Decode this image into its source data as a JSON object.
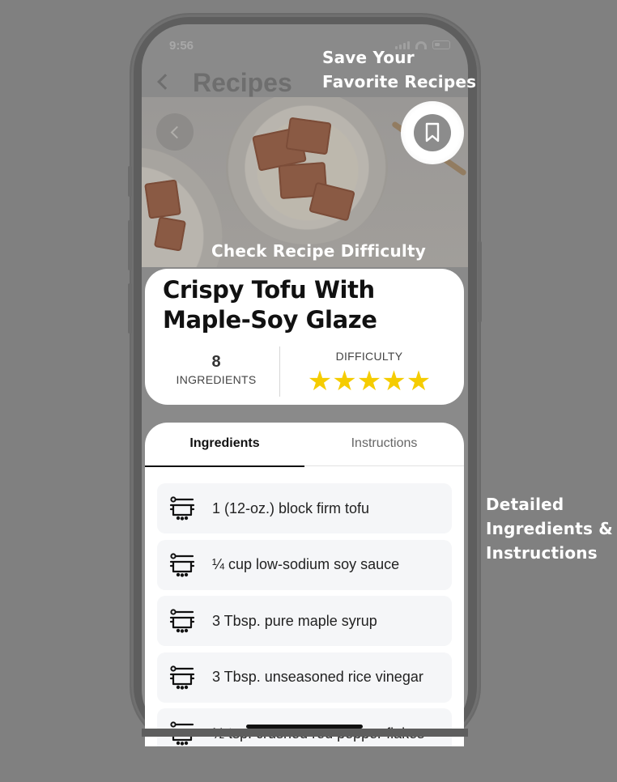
{
  "status": {
    "time": "9:56"
  },
  "header": {
    "title": "Recipes"
  },
  "callouts": {
    "save_line1": "Save Your",
    "save_line2": "Favorite Recipes",
    "difficulty": "Check Recipe Difficulty",
    "details_line1": "Detailed",
    "details_line2": "Ingredients &",
    "details_line3": "Instructions"
  },
  "recipe": {
    "name": "Crispy Tofu With Maple-Soy Glaze",
    "ingredient_count": "8",
    "ingredient_label": "INGREDIENTS",
    "difficulty_label": "DIFFICULTY",
    "difficulty_stars": 5
  },
  "tabs": [
    {
      "label": "Ingredients",
      "active": true
    },
    {
      "label": "Instructions",
      "active": false
    }
  ],
  "ingredients": [
    {
      "text": "1 (12-oz.) block firm tofu",
      "icon": "pot-icon"
    },
    {
      "text": "¼ cup low-sodium soy sauce",
      "icon": "pot-icon"
    },
    {
      "text": "3 Tbsp. pure maple syrup",
      "icon": "pot-icon"
    },
    {
      "text": "3 Tbsp. unseasoned rice vinegar",
      "icon": "pot-icon"
    },
    {
      "text": "½ tsp. crushed red pepper flakes",
      "icon": "pot-icon"
    }
  ],
  "colors": {
    "star": "#f5cc00",
    "overlay": "#808080",
    "card": "#ffffff"
  }
}
